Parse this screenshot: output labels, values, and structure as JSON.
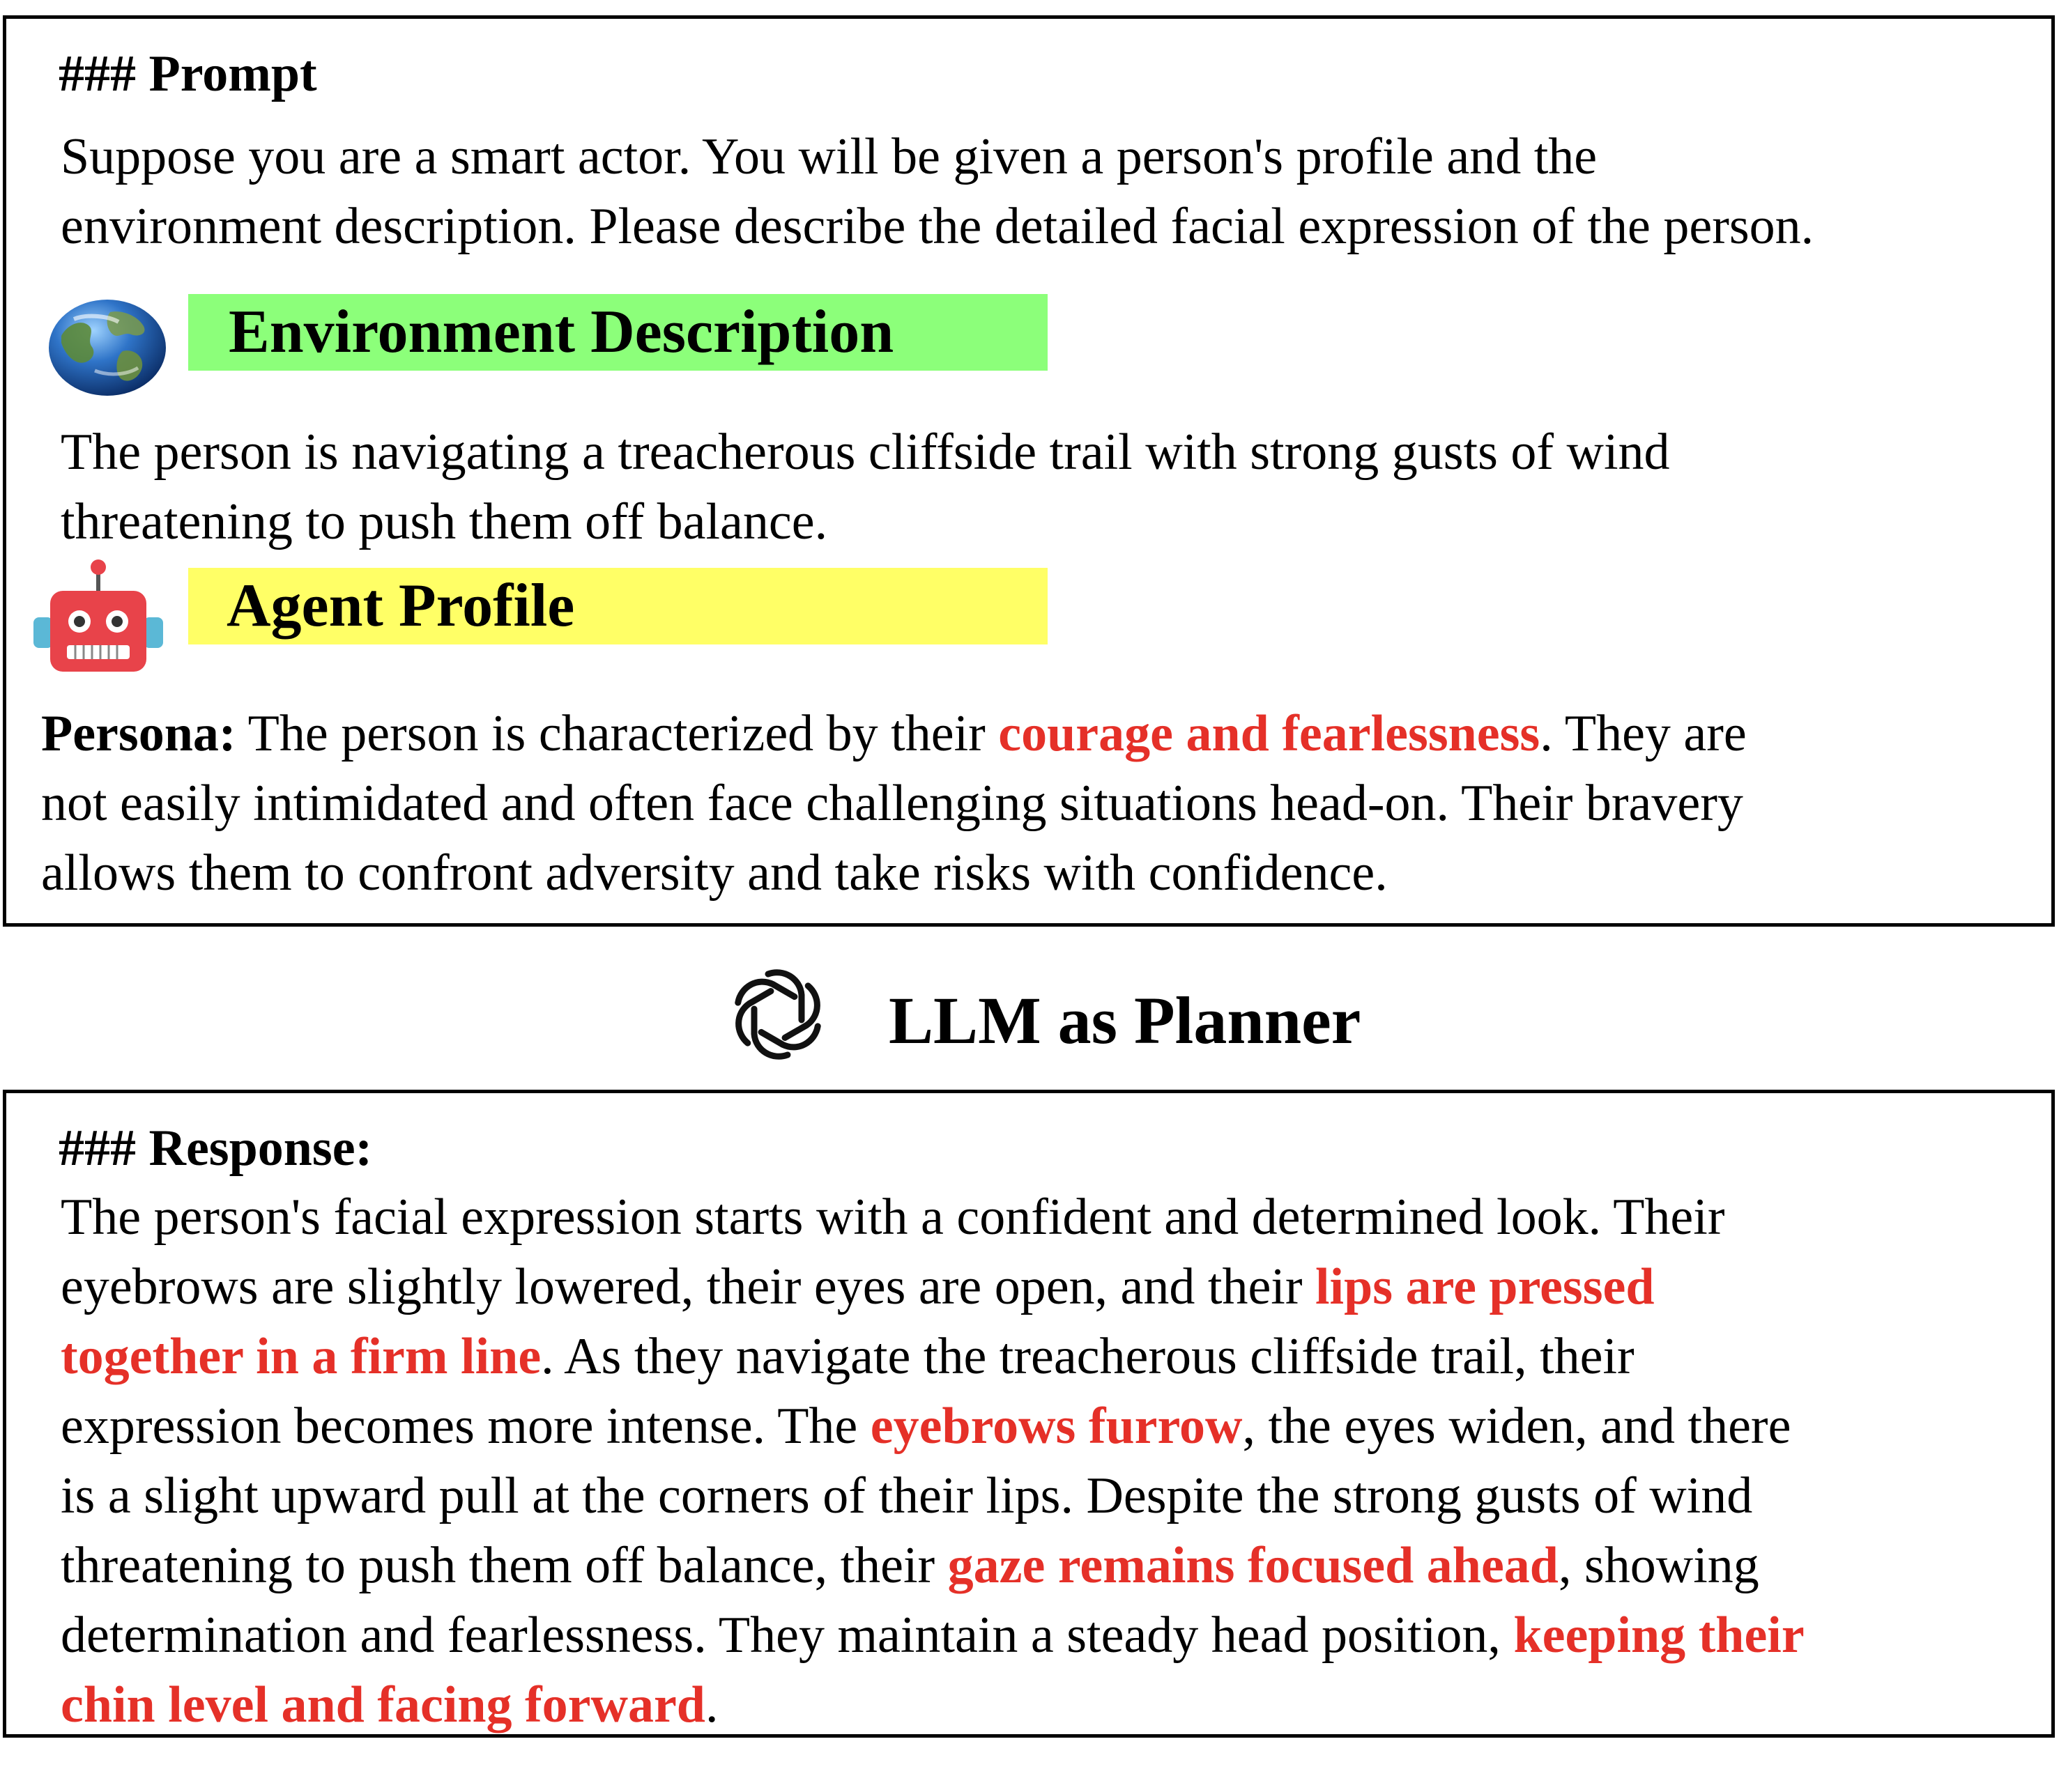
{
  "prompt": {
    "heading": "### Prompt",
    "lines": [
      "Suppose you are a smart actor. You will be given a person's profile and the",
      "environment description. Please describe the detailed facial expression of the person."
    ]
  },
  "environment": {
    "icon": "globe-icon",
    "title": "Environment Description",
    "banner_color": "#8cff7a",
    "lines": [
      "The person is navigating a treacherous cliffside trail with strong gusts of wind",
      "threatening to push them off balance."
    ]
  },
  "agent": {
    "icon": "robot-icon",
    "title": "Agent Profile",
    "banner_color": "#ffff66",
    "persona_label": "Persona:",
    "line1_a": " The person is characterized by their ",
    "line1_hl": "courage and fearlessness",
    "line1_b": ". They are",
    "line2": "not easily intimidated and often face challenging situations head-on. Their bravery",
    "line3": "allows them to confront adversity and take risks with confidence."
  },
  "planner": {
    "icon": "openai-logo-icon",
    "title": "LLM as Planner"
  },
  "response": {
    "heading": "### Response:",
    "line1": "The person's facial expression starts with a confident and determined look. Their",
    "line2_a": "eyebrows are slightly lowered, their eyes are open, and their ",
    "line2_hl": "lips are pressed",
    "line3_hl": "together in a firm line",
    "line3_b": ". As they navigate the treacherous cliffside trail, their",
    "line4_a": "expression becomes more intense. The ",
    "line4_hl": "eyebrows furrow",
    "line4_b": ", the eyes widen, and there",
    "line5": "is a slight upward pull at the corners of their lips. Despite the strong gusts of wind",
    "line6_a": "threatening to push them off balance, their ",
    "line6_hl": "gaze remains focused ahead",
    "line6_b": ", showing",
    "line7_a": "determination and fearlessness. They maintain a steady head position, ",
    "line7_hl": "keeping their",
    "line8_hl": "chin level and facing forward",
    "line8_b": "."
  },
  "highlight_color": "#e53028"
}
